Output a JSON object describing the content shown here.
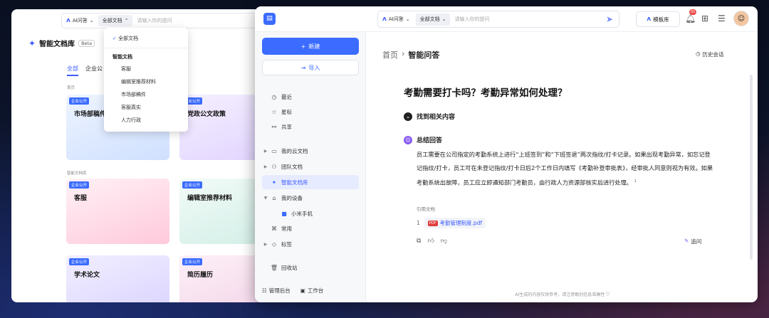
{
  "back_window": {
    "topbar": {
      "ai_label": "AI问答",
      "scope": "全部文档",
      "placeholder": "请输入你的提问"
    },
    "title": "智能文档库",
    "beta": "Beta",
    "tabs": [
      "全部",
      "企业公"
    ],
    "section_home": "首页",
    "section_lib": "智能文档库",
    "cards": [
      {
        "badge": "企业公开",
        "title": "市场部稿件"
      },
      {
        "badge": "企业公开",
        "title": "党政公文政策"
      },
      {
        "badge": "企业公开",
        "title": "客服"
      },
      {
        "badge": "企业公开",
        "title": "编辑室推荐材料"
      },
      {
        "badge": "企业公开",
        "title": "学术论文"
      },
      {
        "badge": "企业公开",
        "title": "简历履历"
      }
    ],
    "dropdown": {
      "selected": "全部文档",
      "group": "智能文档",
      "items": [
        "客服",
        "编辑室推荐材料",
        "市场部稿件",
        "客服真实",
        "人力行政"
      ]
    }
  },
  "header": {
    "ai_label": "AI问答",
    "scope": "全部文档",
    "placeholder": "请输入你的提问",
    "template_btn": "模板库",
    "notif_count": "50"
  },
  "sidebar": {
    "new_btn": "新建",
    "import_btn": "导入",
    "items": [
      {
        "label": "最近",
        "icon": "clock-icon"
      },
      {
        "label": "星标",
        "icon": "star-icon"
      },
      {
        "label": "共享",
        "icon": "share-icon"
      },
      {
        "label": "我的云文档",
        "icon": "folder-icon"
      },
      {
        "label": "团队文档",
        "icon": "team-icon"
      },
      {
        "label": "智能文档库",
        "icon": "ai-doc-icon"
      },
      {
        "label": "我的设备",
        "icon": "device-icon"
      },
      {
        "label": "小米手机",
        "icon": "folder-blue-icon"
      },
      {
        "label": "常用",
        "icon": "pin-icon"
      },
      {
        "label": "标签",
        "icon": "tag-icon"
      },
      {
        "label": "回收站",
        "icon": "trash-icon"
      }
    ],
    "footer_admin": "管理后台",
    "footer_workspace": "工作台"
  },
  "main": {
    "breadcrumb_home": "首页",
    "breadcrumb_sep": "›",
    "breadcrumb_current": "智能问答",
    "history": "历史会话",
    "question": "考勤需要打卡吗？考勤异常如何处理？",
    "found_heading": "找到相关内容",
    "summary_heading": "总结回答",
    "answer": "员工需要在公司指定的考勤系统上进行“上班签到”和“下班签退”两次指纹/打卡记录。如果出现考勤异常，如忘记登记指纹/打卡，员工可在未登记指纹/打卡日后2个工作日内填写《考勤补登审批表》，经审批人同意则视为有效。如果考勤系统出故障，员工应立即通知部门考勤员，由行政人力资源部核实后进行处理。",
    "answer_sup": "1",
    "cite_label": "引用文档",
    "cite_num": "1",
    "cite_file": "考勤管理制度.pdf",
    "pdf_tag": "PDF",
    "followup": "追问",
    "disclaimer": "AI生成的内容仅供参考，请注意甄别信息准确性"
  },
  "colors": {
    "accent": "#3b6cff",
    "badge_red": "#f04848"
  }
}
